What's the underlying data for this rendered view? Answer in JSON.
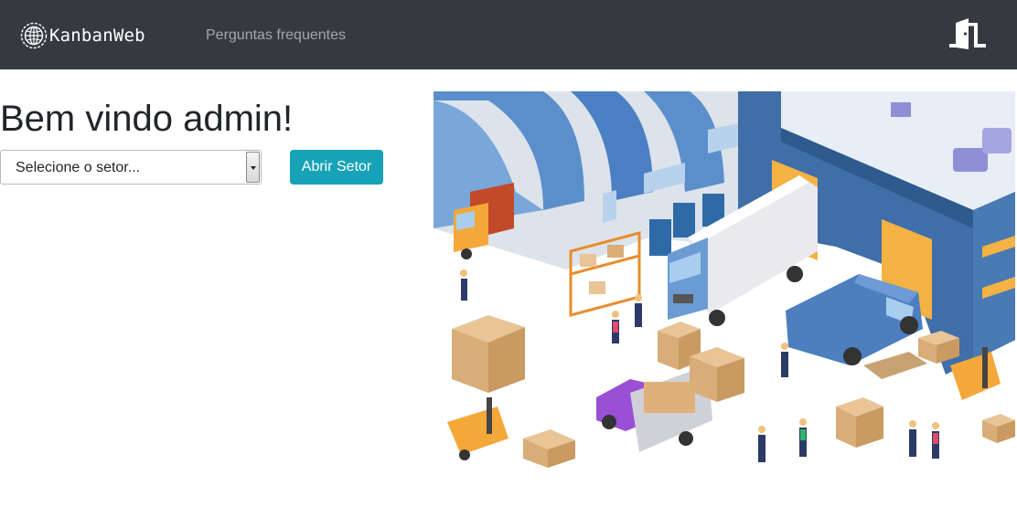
{
  "navbar": {
    "brand": "KanbanWeb",
    "links": [
      "Perguntas frequentes"
    ],
    "exit_icon": "door-exit-icon"
  },
  "main": {
    "welcome": "Bem vindo admin!",
    "sector_select": {
      "selected": "Selecione o setor..."
    },
    "open_button": "Abrir Setor",
    "illustration": "warehouse-logistics-illustration"
  },
  "colors": {
    "navbar_bg": "#343a40",
    "button_bg": "#17a2b8",
    "nav_link": "rgba(255,255,255,0.55)"
  }
}
